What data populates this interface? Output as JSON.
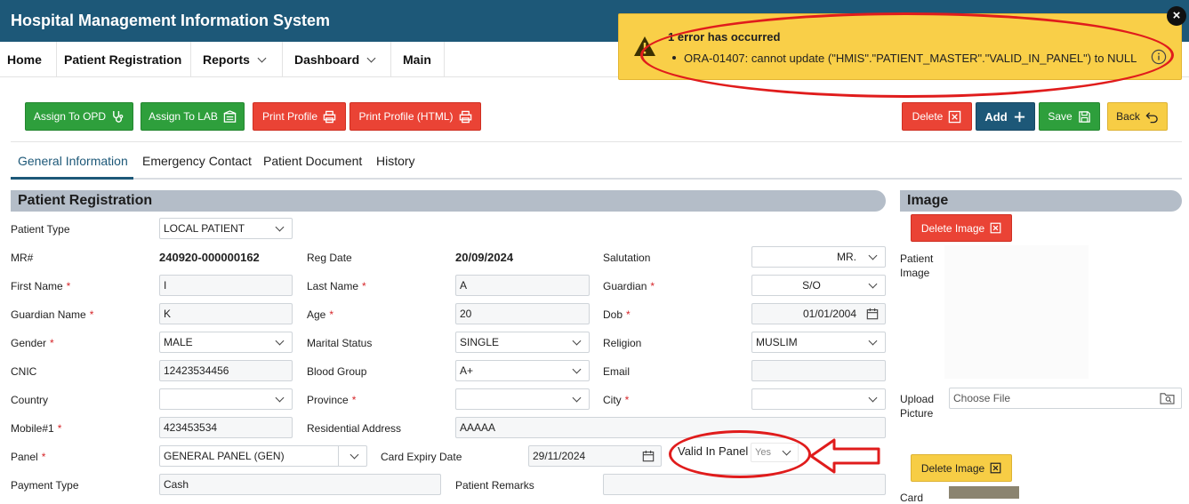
{
  "header": {
    "title": "Hospital Management Information System"
  },
  "nav": {
    "items": [
      {
        "label": "Home"
      },
      {
        "label": "Patient Registration"
      },
      {
        "label": "Reports"
      },
      {
        "label": "Dashboard"
      },
      {
        "label": "Main"
      }
    ]
  },
  "toolbar": {
    "assign_opd": "Assign To OPD",
    "assign_lab": "Assign To LAB",
    "print_profile": "Print Profile",
    "print_profile_html": "Print Profile (HTML)",
    "delete": "Delete",
    "add": "Add",
    "save": "Save",
    "back": "Back"
  },
  "tabs": [
    {
      "label": "General Information"
    },
    {
      "label": "Emergency Contact"
    },
    {
      "label": "Patient Document"
    },
    {
      "label": "History"
    }
  ],
  "sections": {
    "registration": "Patient Registration",
    "image": "Image"
  },
  "form": {
    "patient_type": {
      "label": "Patient Type",
      "value": "LOCAL PATIENT"
    },
    "mr": {
      "label": "MR#",
      "value": "240920-000000162"
    },
    "reg_date": {
      "label": "Reg Date",
      "value": "20/09/2024"
    },
    "salutation": {
      "label": "Salutation",
      "value": "MR."
    },
    "first_name": {
      "label": "First Name",
      "value": "I"
    },
    "last_name": {
      "label": "Last Name",
      "value": "A"
    },
    "guardian": {
      "label": "Guardian",
      "value": "S/O"
    },
    "guardian_name": {
      "label": "Guardian Name",
      "value": "K"
    },
    "age": {
      "label": "Age",
      "value": "20"
    },
    "dob": {
      "label": "Dob",
      "value": "01/01/2004"
    },
    "gender": {
      "label": "Gender",
      "value": "MALE"
    },
    "marital_status": {
      "label": "Marital Status",
      "value": "SINGLE"
    },
    "religion": {
      "label": "Religion",
      "value": "MUSLIM"
    },
    "cnic": {
      "label": "CNIC",
      "value": "12423534456"
    },
    "blood_group": {
      "label": "Blood Group",
      "value": "A+"
    },
    "email": {
      "label": "Email",
      "value": ""
    },
    "country": {
      "label": "Country",
      "value": ""
    },
    "province": {
      "label": "Province",
      "value": ""
    },
    "city": {
      "label": "City",
      "value": ""
    },
    "mobile": {
      "label": "Mobile#1",
      "value": "423453534"
    },
    "residential_address": {
      "label": "Residential Address",
      "value": "AAAAA"
    },
    "panel": {
      "label": "Panel",
      "value": "GENERAL PANEL (GEN)"
    },
    "card_expiry": {
      "label": "Card Expiry Date",
      "value": "29/11/2024"
    },
    "valid_in_panel": {
      "label": "Valid In Panel",
      "value": "Yes"
    },
    "payment_type": {
      "label": "Payment Type",
      "value": "Cash"
    },
    "patient_remarks": {
      "label": "Patient Remarks",
      "value": ""
    }
  },
  "image_panel": {
    "delete_image": "Delete Image",
    "patient_image_label": "Patient Image",
    "upload_label": "Upload Picture",
    "choose_file": "Choose File",
    "delete_image_2": "Delete Image",
    "card_label": "Card"
  },
  "error_toast": {
    "title": "1 error has occurred",
    "message": "ORA-01407: cannot update (\"HMIS\".\"PATIENT_MASTER\".\"VALID_IN_PANEL\") to NULL",
    "close": "×"
  },
  "colors": {
    "header": "#1d5878",
    "green": "#2e9f3c",
    "red": "#ea4335",
    "yellow": "#f7cd45",
    "toast": "#f9cf48",
    "annotation": "#e01c1c"
  }
}
